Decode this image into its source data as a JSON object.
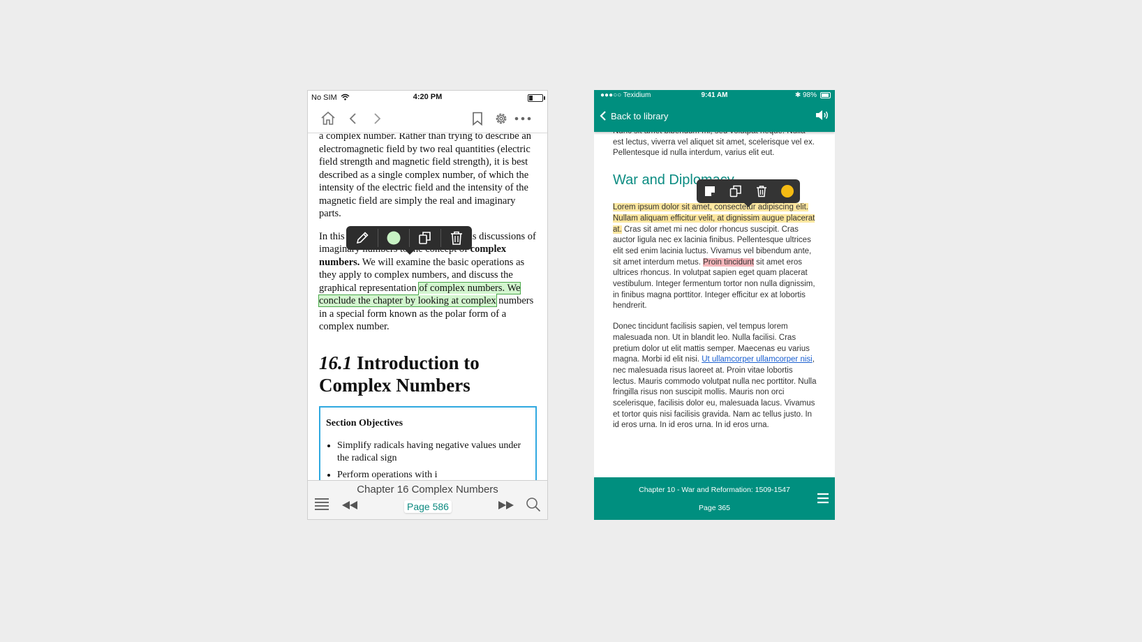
{
  "left": {
    "status": {
      "carrier": "No SIM",
      "time": "4:20 PM"
    },
    "paragraph1": "a complex number. Rather than trying to describe an electromagnetic field by two real quantities (electric field strength and magnetic field strength), it is best described as a single complex number, of which the intensity of the electric field and the intensity of the magnetic field are simply the real and imaginary parts.",
    "paragraph2": {
      "part1": "In this chapter we expand our previous discussions of imaginary numbers to the concept of ",
      "bold": "complex numbers.",
      "part2": " We will examine the basic operations as they apply to complex numbers, and discuss the graphical representation ",
      "highlight": "of complex numbers. We conclude the chapter by looking at complex",
      "part3": " numbers in a special form known as the polar form of a complex number."
    },
    "heading": {
      "number": "16.1",
      "title": "Introduction to Complex Numbers"
    },
    "objectives": {
      "title": "Section Objectives",
      "items": [
        "Simplify radicals having negative values under the radical sign",
        "Perform operations with i"
      ]
    },
    "bottom": {
      "chapter": "Chapter 16 Complex Numbers",
      "page": "Page 586"
    },
    "colors": {
      "highlight": "#d3f5cf",
      "accent": "#0d8a80",
      "box_border": "#2fa8e0"
    }
  },
  "right": {
    "status": {
      "carrier": "Texidium",
      "time": "9:41 AM",
      "battery": "98%"
    },
    "back_label": "Back to library",
    "para_top": "Nunc sit amet bibendum mi, sed volutpat neque. Nulla est lectus, viverra vel aliquet sit amet, scelerisque vel ex. Pellentesque id nulla interdum, varius elit eut.",
    "heading": "War and Diplomacy",
    "para_main": {
      "highlight_yellow": "Lorem ipsum dolor sit amet, consectetur adipiscing elit. Nullam aliquam efficitur velit, at dignissim augue placerat at.",
      "part1": " Cras sit amet mi nec dolor rhoncus suscipit. Cras auctor ligula nec ex lacinia finibus. Pellentesque ultrices elit sed enim lacinia luctus. Vivamus vel bibendum ante, sit amet interdum metus. ",
      "highlight_red": "Proin tincidunt",
      "part2": " sit amet eros ultrices rhoncus. In volutpat sapien eget quam placerat vestibulum. Integer fermentum tortor non nulla dignissim, in finibus magna porttitor. Integer efficitur ex at lobortis hendrerit."
    },
    "para_second": {
      "part1": "Donec tincidunt facilisis sapien, vel tempus lorem malesuada non. Ut in blandit leo. Nulla facilisi. Cras pretium dolor ut elit mattis semper. Maecenas eu varius magna. Morbi id elit nisi. ",
      "link": "Ut ullamcorper ullamcorper nisi",
      "part2": ", nec malesuada risus laoreet at. Proin vitae lobortis lectus. Mauris commodo volutpat nulla nec porttitor. Nulla fringilla risus non suscipit mollis. Mauris non orci scelerisque, facilisis dolor eu, malesuada lacus. Vivamus et tortor quis nisi facilisis gravida. Nam ac tellus justo. In id eros urna. In id eros urna. In id eros urna."
    },
    "bottom": {
      "chapter": "Chapter 10 - War and Reformation: 1509-1547",
      "page": "Page 365"
    },
    "colors": {
      "brand": "#008f7f",
      "heading": "#0b8c82",
      "highlight_yellow": "#fde7a0",
      "highlight_red": "#f6b6bb",
      "link": "#1a5fd0",
      "color_dot": "#f5bb13"
    }
  }
}
